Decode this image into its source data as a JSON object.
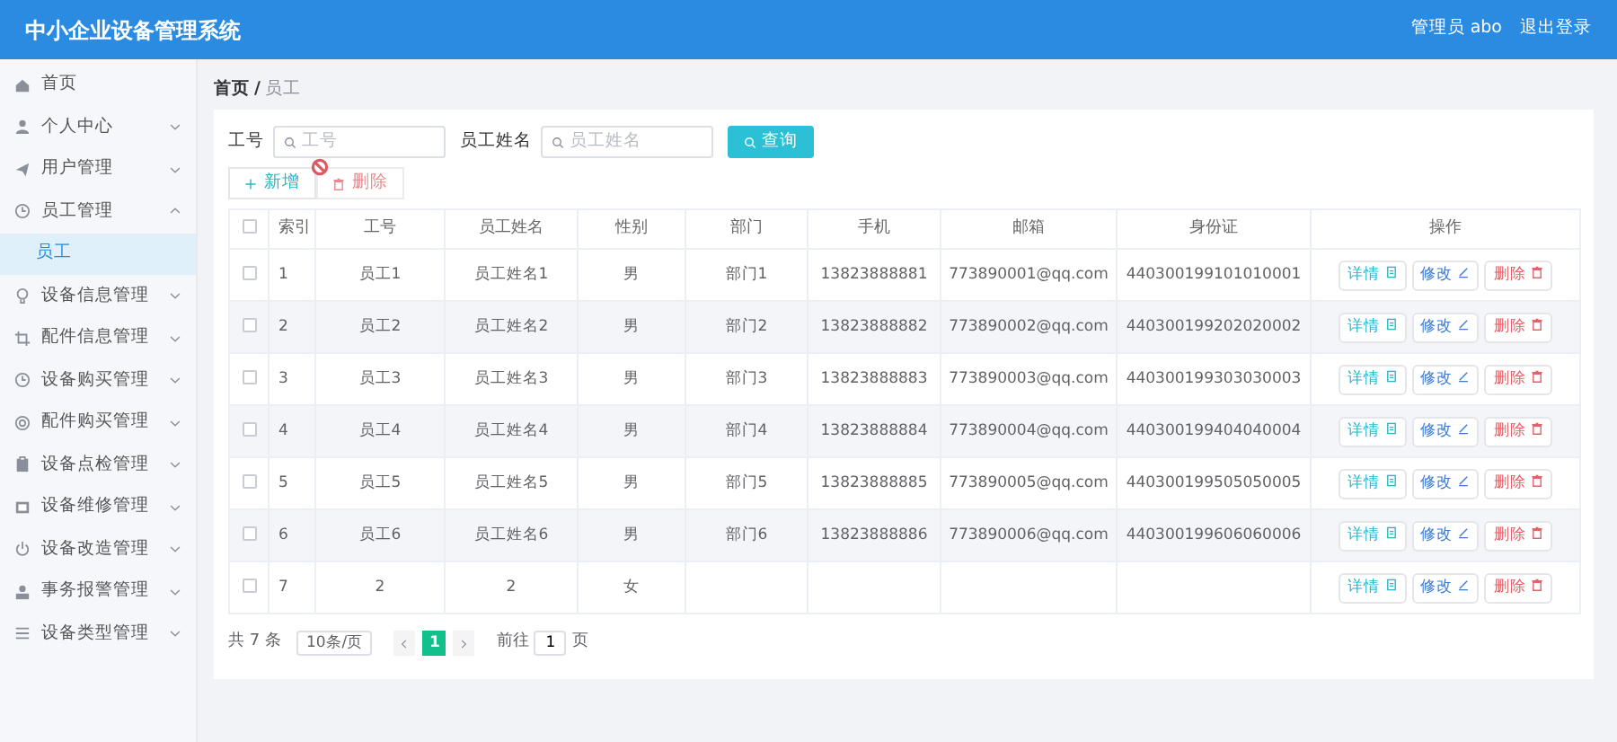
{
  "header": {
    "title": "中小企业设备管理系统",
    "user": "管理员 abo",
    "logout": "退出登录"
  },
  "sidebar": {
    "items": [
      {
        "label": "首页",
        "kind": "link",
        "selected": false
      },
      {
        "label": "个人中心",
        "kind": "menu",
        "expanded": false,
        "selected": false
      },
      {
        "label": "用户管理",
        "kind": "menu",
        "expanded": false,
        "selected": false
      },
      {
        "label": "员工管理",
        "kind": "menu",
        "expanded": true,
        "selected": false,
        "children": [
          {
            "label": "员工",
            "selected": true
          }
        ]
      },
      {
        "label": "设备信息管理",
        "kind": "menu",
        "expanded": false,
        "selected": false
      },
      {
        "label": "配件信息管理",
        "kind": "menu",
        "expanded": false,
        "selected": false
      },
      {
        "label": "设备购买管理",
        "kind": "menu",
        "expanded": false,
        "selected": false
      },
      {
        "label": "配件购买管理",
        "kind": "menu",
        "expanded": false,
        "selected": false
      },
      {
        "label": "设备点检管理",
        "kind": "menu",
        "expanded": false,
        "selected": false
      },
      {
        "label": "设备维修管理",
        "kind": "menu",
        "expanded": false,
        "selected": false
      },
      {
        "label": "设备改造管理",
        "kind": "menu",
        "expanded": false,
        "selected": false
      },
      {
        "label": "事务报警管理",
        "kind": "menu",
        "expanded": false,
        "selected": false
      },
      {
        "label": "设备类型管理",
        "kind": "menu",
        "expanded": false,
        "selected": false
      }
    ]
  },
  "breadcrumb": [
    "首页",
    "员工"
  ],
  "breadcrumb_separator": "/",
  "search": {
    "fields": [
      {
        "label": "工号",
        "placeholder": "工号"
      },
      {
        "label": "员工姓名",
        "placeholder": "员工姓名"
      }
    ],
    "button": "查询"
  },
  "toolbar": [
    {
      "label": "新增",
      "kind": "add",
      "disabled": false
    },
    {
      "label": "删除",
      "kind": "delete",
      "disabled": true
    }
  ],
  "table": {
    "select_all": {
      "checked": false
    },
    "columns": [
      "索引",
      "工号",
      "员工姓名",
      "性别",
      "部门",
      "手机",
      "邮箱",
      "身份证",
      "操作"
    ],
    "rows": [
      {
        "checked": false,
        "cells": [
          "1",
          "员工1",
          "员工姓名1",
          "男",
          "部门1",
          "13823888881",
          "773890001@qq.com",
          "440300199101010001"
        ],
        "actions": [
          {
            "label": "详情",
            "kind": "detail"
          },
          {
            "label": "修改",
            "kind": "edit"
          },
          {
            "label": "删除",
            "kind": "delete"
          }
        ]
      },
      {
        "checked": false,
        "cells": [
          "2",
          "员工2",
          "员工姓名2",
          "男",
          "部门2",
          "13823888882",
          "773890002@qq.com",
          "440300199202020002"
        ],
        "actions": [
          {
            "label": "详情",
            "kind": "detail"
          },
          {
            "label": "修改",
            "kind": "edit"
          },
          {
            "label": "删除",
            "kind": "delete"
          }
        ]
      },
      {
        "checked": false,
        "cells": [
          "3",
          "员工3",
          "员工姓名3",
          "男",
          "部门3",
          "13823888883",
          "773890003@qq.com",
          "440300199303030003"
        ],
        "actions": [
          {
            "label": "详情",
            "kind": "detail"
          },
          {
            "label": "修改",
            "kind": "edit"
          },
          {
            "label": "删除",
            "kind": "delete"
          }
        ]
      },
      {
        "checked": false,
        "cells": [
          "4",
          "员工4",
          "员工姓名4",
          "男",
          "部门4",
          "13823888884",
          "773890004@qq.com",
          "440300199404040004"
        ],
        "actions": [
          {
            "label": "详情",
            "kind": "detail"
          },
          {
            "label": "修改",
            "kind": "edit"
          },
          {
            "label": "删除",
            "kind": "delete"
          }
        ]
      },
      {
        "checked": false,
        "cells": [
          "5",
          "员工5",
          "员工姓名5",
          "男",
          "部门5",
          "13823888885",
          "773890005@qq.com",
          "440300199505050005"
        ],
        "actions": [
          {
            "label": "详情",
            "kind": "detail"
          },
          {
            "label": "修改",
            "kind": "edit"
          },
          {
            "label": "删除",
            "kind": "delete"
          }
        ]
      },
      {
        "checked": false,
        "cells": [
          "6",
          "员工6",
          "员工姓名6",
          "男",
          "部门6",
          "13823888886",
          "773890006@qq.com",
          "440300199606060006"
        ],
        "actions": [
          {
            "label": "详情",
            "kind": "detail"
          },
          {
            "label": "修改",
            "kind": "edit"
          },
          {
            "label": "删除",
            "kind": "delete"
          }
        ]
      },
      {
        "checked": false,
        "cells": [
          "7",
          "2",
          "2",
          "女",
          "",
          "",
          "",
          ""
        ],
        "actions": [
          {
            "label": "详情",
            "kind": "detail"
          },
          {
            "label": "修改",
            "kind": "edit"
          },
          {
            "label": "删除",
            "kind": "delete"
          }
        ]
      }
    ]
  },
  "pagination": {
    "total": "共 7 条",
    "page_size": "10条/页",
    "pages": [
      {
        "label": "1",
        "selected": true
      }
    ],
    "goto_label": "前往",
    "goto_value": "1",
    "goto_suffix": "页"
  }
}
